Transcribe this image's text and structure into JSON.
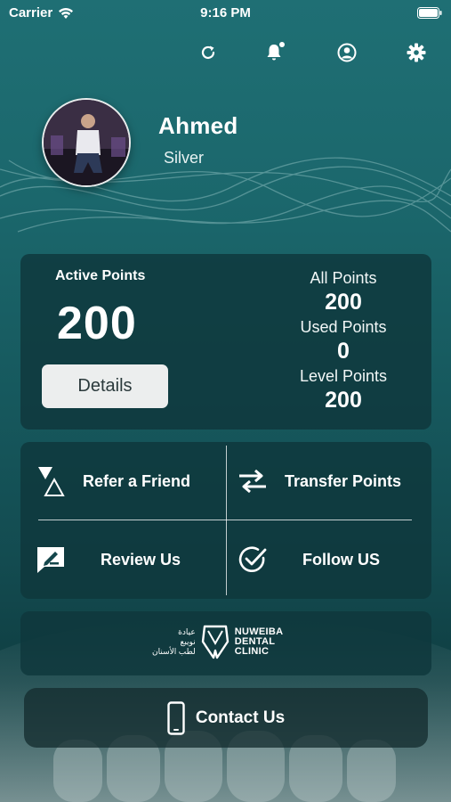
{
  "status_bar": {
    "carrier": "Carrier",
    "time": "9:16 PM"
  },
  "toolbar": {
    "icons": [
      "refresh-icon",
      "bell-icon",
      "profile-icon",
      "gear-icon"
    ]
  },
  "profile": {
    "name": "Ahmed",
    "level": "Silver"
  },
  "points": {
    "active_label": "Active Points",
    "active_value": "200",
    "details_label": "Details",
    "all_label": "All Points",
    "all_value": "200",
    "used_label": "Used Points",
    "used_value": "0",
    "level_label": "Level Points",
    "level_value": "200"
  },
  "actions": {
    "refer": "Refer a Friend",
    "transfer": "Transfer Points",
    "review": "Review Us",
    "follow": "Follow US"
  },
  "logo": {
    "ar_line1": "عيادة",
    "ar_line2": "نويبع",
    "ar_line3": "لطب الأسنان",
    "en_line1": "NUWEIBA",
    "en_line2": "DENTAL",
    "en_line3": "CLINIC"
  },
  "contact": {
    "label": "Contact Us"
  },
  "colors": {
    "background_top": "#1f6f74",
    "card": "#0f373c",
    "button": "#eceeee"
  }
}
